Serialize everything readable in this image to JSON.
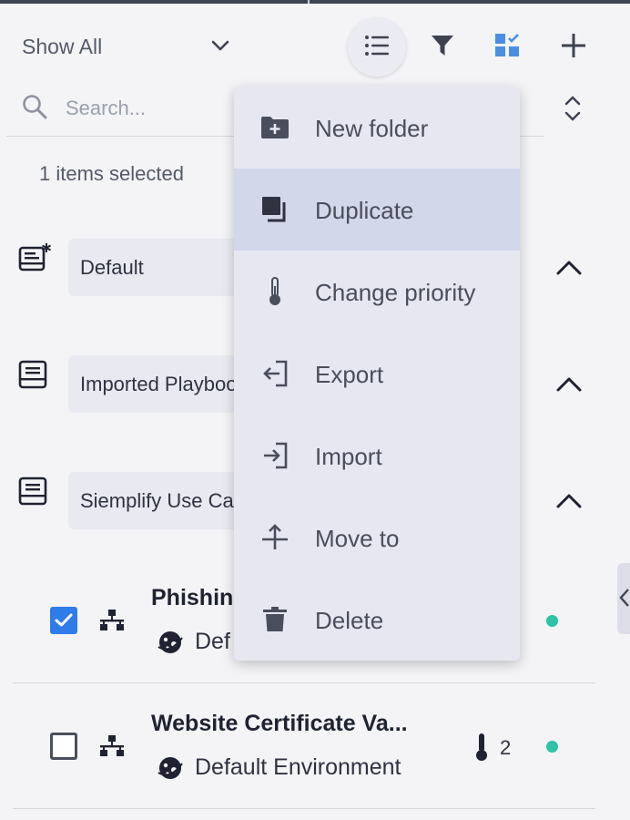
{
  "toolbar": {
    "filter_select_value": "Show All"
  },
  "search": {
    "placeholder": "Search..."
  },
  "selection": {
    "count_text": "1 items selected"
  },
  "folders": [
    {
      "label": "Default"
    },
    {
      "label": "Imported Playbooks"
    },
    {
      "label": "Siemplify Use Cases"
    }
  ],
  "playbooks": [
    {
      "title": "Phishing",
      "environment": "Default Environment",
      "priority": "",
      "checked": true
    },
    {
      "title": "Website Certificate Va...",
      "environment": "Default Environment",
      "priority": "2",
      "checked": false
    }
  ],
  "menu": {
    "items": [
      {
        "label": "New folder",
        "icon": "folder-plus-icon"
      },
      {
        "label": "Duplicate",
        "icon": "duplicate-icon"
      },
      {
        "label": "Change priority",
        "icon": "thermometer-icon"
      },
      {
        "label": "Export",
        "icon": "export-icon"
      },
      {
        "label": "Import",
        "icon": "import-icon"
      },
      {
        "label": "Move to",
        "icon": "move-to-icon"
      },
      {
        "label": "Delete",
        "icon": "trash-icon"
      }
    ],
    "highlighted": "Duplicate"
  },
  "colors": {
    "accent": "#2f7bea",
    "status_active": "#2bc4a6",
    "menu_bg": "#e7e7f1",
    "menu_highlight": "#d3d7ea"
  }
}
